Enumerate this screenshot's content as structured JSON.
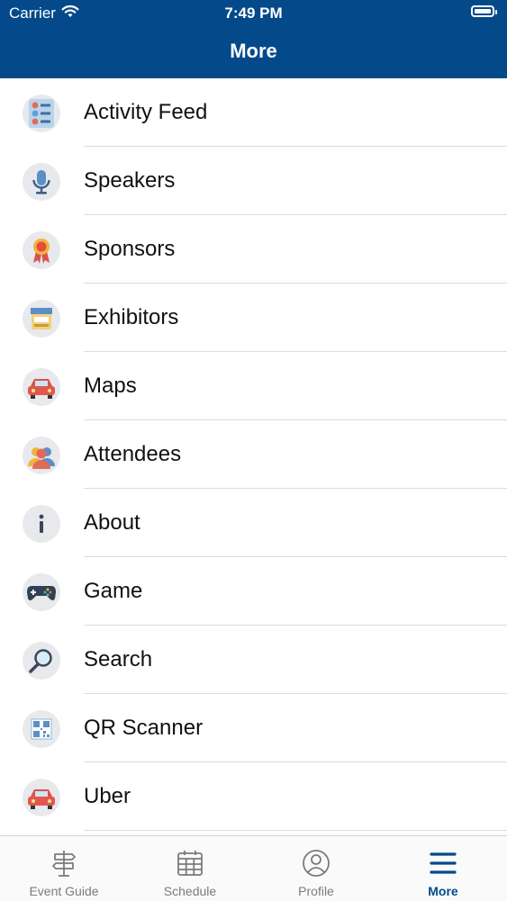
{
  "status_bar": {
    "carrier": "Carrier",
    "time": "7:49 PM"
  },
  "header": {
    "title": "More"
  },
  "menu": [
    {
      "label": "Activity Feed",
      "icon": "activity-feed-icon"
    },
    {
      "label": "Speakers",
      "icon": "microphone-icon"
    },
    {
      "label": "Sponsors",
      "icon": "award-ribbon-icon"
    },
    {
      "label": "Exhibitors",
      "icon": "storefront-icon"
    },
    {
      "label": "Maps",
      "icon": "car-icon"
    },
    {
      "label": "Attendees",
      "icon": "people-icon"
    },
    {
      "label": "About",
      "icon": "info-icon"
    },
    {
      "label": "Game",
      "icon": "gamepad-icon"
    },
    {
      "label": "Search",
      "icon": "magnifier-icon"
    },
    {
      "label": "QR Scanner",
      "icon": "qr-code-icon"
    },
    {
      "label": "Uber",
      "icon": "car-icon"
    }
  ],
  "tabs": [
    {
      "label": "Event Guide",
      "icon": "signpost-icon"
    },
    {
      "label": "Schedule",
      "icon": "calendar-icon"
    },
    {
      "label": "Profile",
      "icon": "user-circle-icon"
    },
    {
      "label": "More",
      "icon": "hamburger-icon",
      "active": true
    }
  ],
  "colors": {
    "brand": "#044a8a",
    "tab_inactive": "#7b7b7b"
  }
}
